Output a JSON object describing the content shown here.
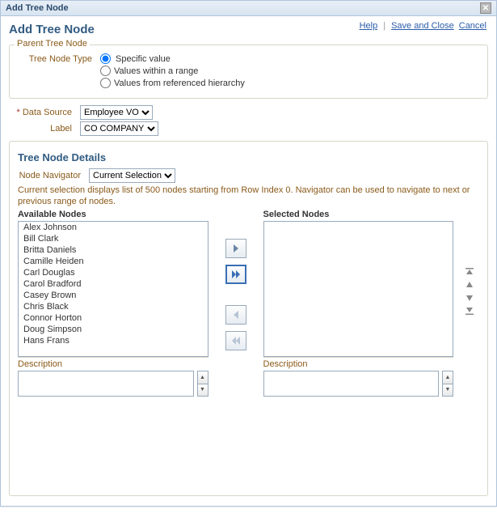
{
  "dialog": {
    "title": "Add Tree Node",
    "page_title": "Add Tree Node"
  },
  "actions": {
    "help": "Help",
    "save_close": "Save and Close",
    "cancel": "Cancel"
  },
  "parent_section": {
    "legend": "Parent Tree Node",
    "type_label": "Tree Node Type",
    "options": {
      "specific": "Specific value",
      "range": "Values within a range",
      "referenced": "Values from referenced hierarchy"
    },
    "selected": "specific"
  },
  "data_source": {
    "label": "Data Source",
    "value": "Employee VO"
  },
  "label_field": {
    "label": "Label",
    "value": "CO COMPANY"
  },
  "details": {
    "title": "Tree Node Details",
    "navigator_label": "Node Navigator",
    "navigator_value": "Current Selection",
    "hint": "Current selection displays list of 500 nodes starting from Row Index 0. Navigator can be used to navigate to next or previous range of nodes.",
    "available_label": "Available Nodes",
    "selected_label": "Selected Nodes",
    "description_label": "Description",
    "available_items": [
      "Alex Johnson",
      "Bill Clark",
      "Britta Daniels",
      "Camille Heiden",
      "Carl Douglas",
      "Carol Bradford",
      "Casey Brown",
      "Chris Black",
      "Connor Horton",
      "Doug Simpson",
      "Hans Frans"
    ]
  }
}
